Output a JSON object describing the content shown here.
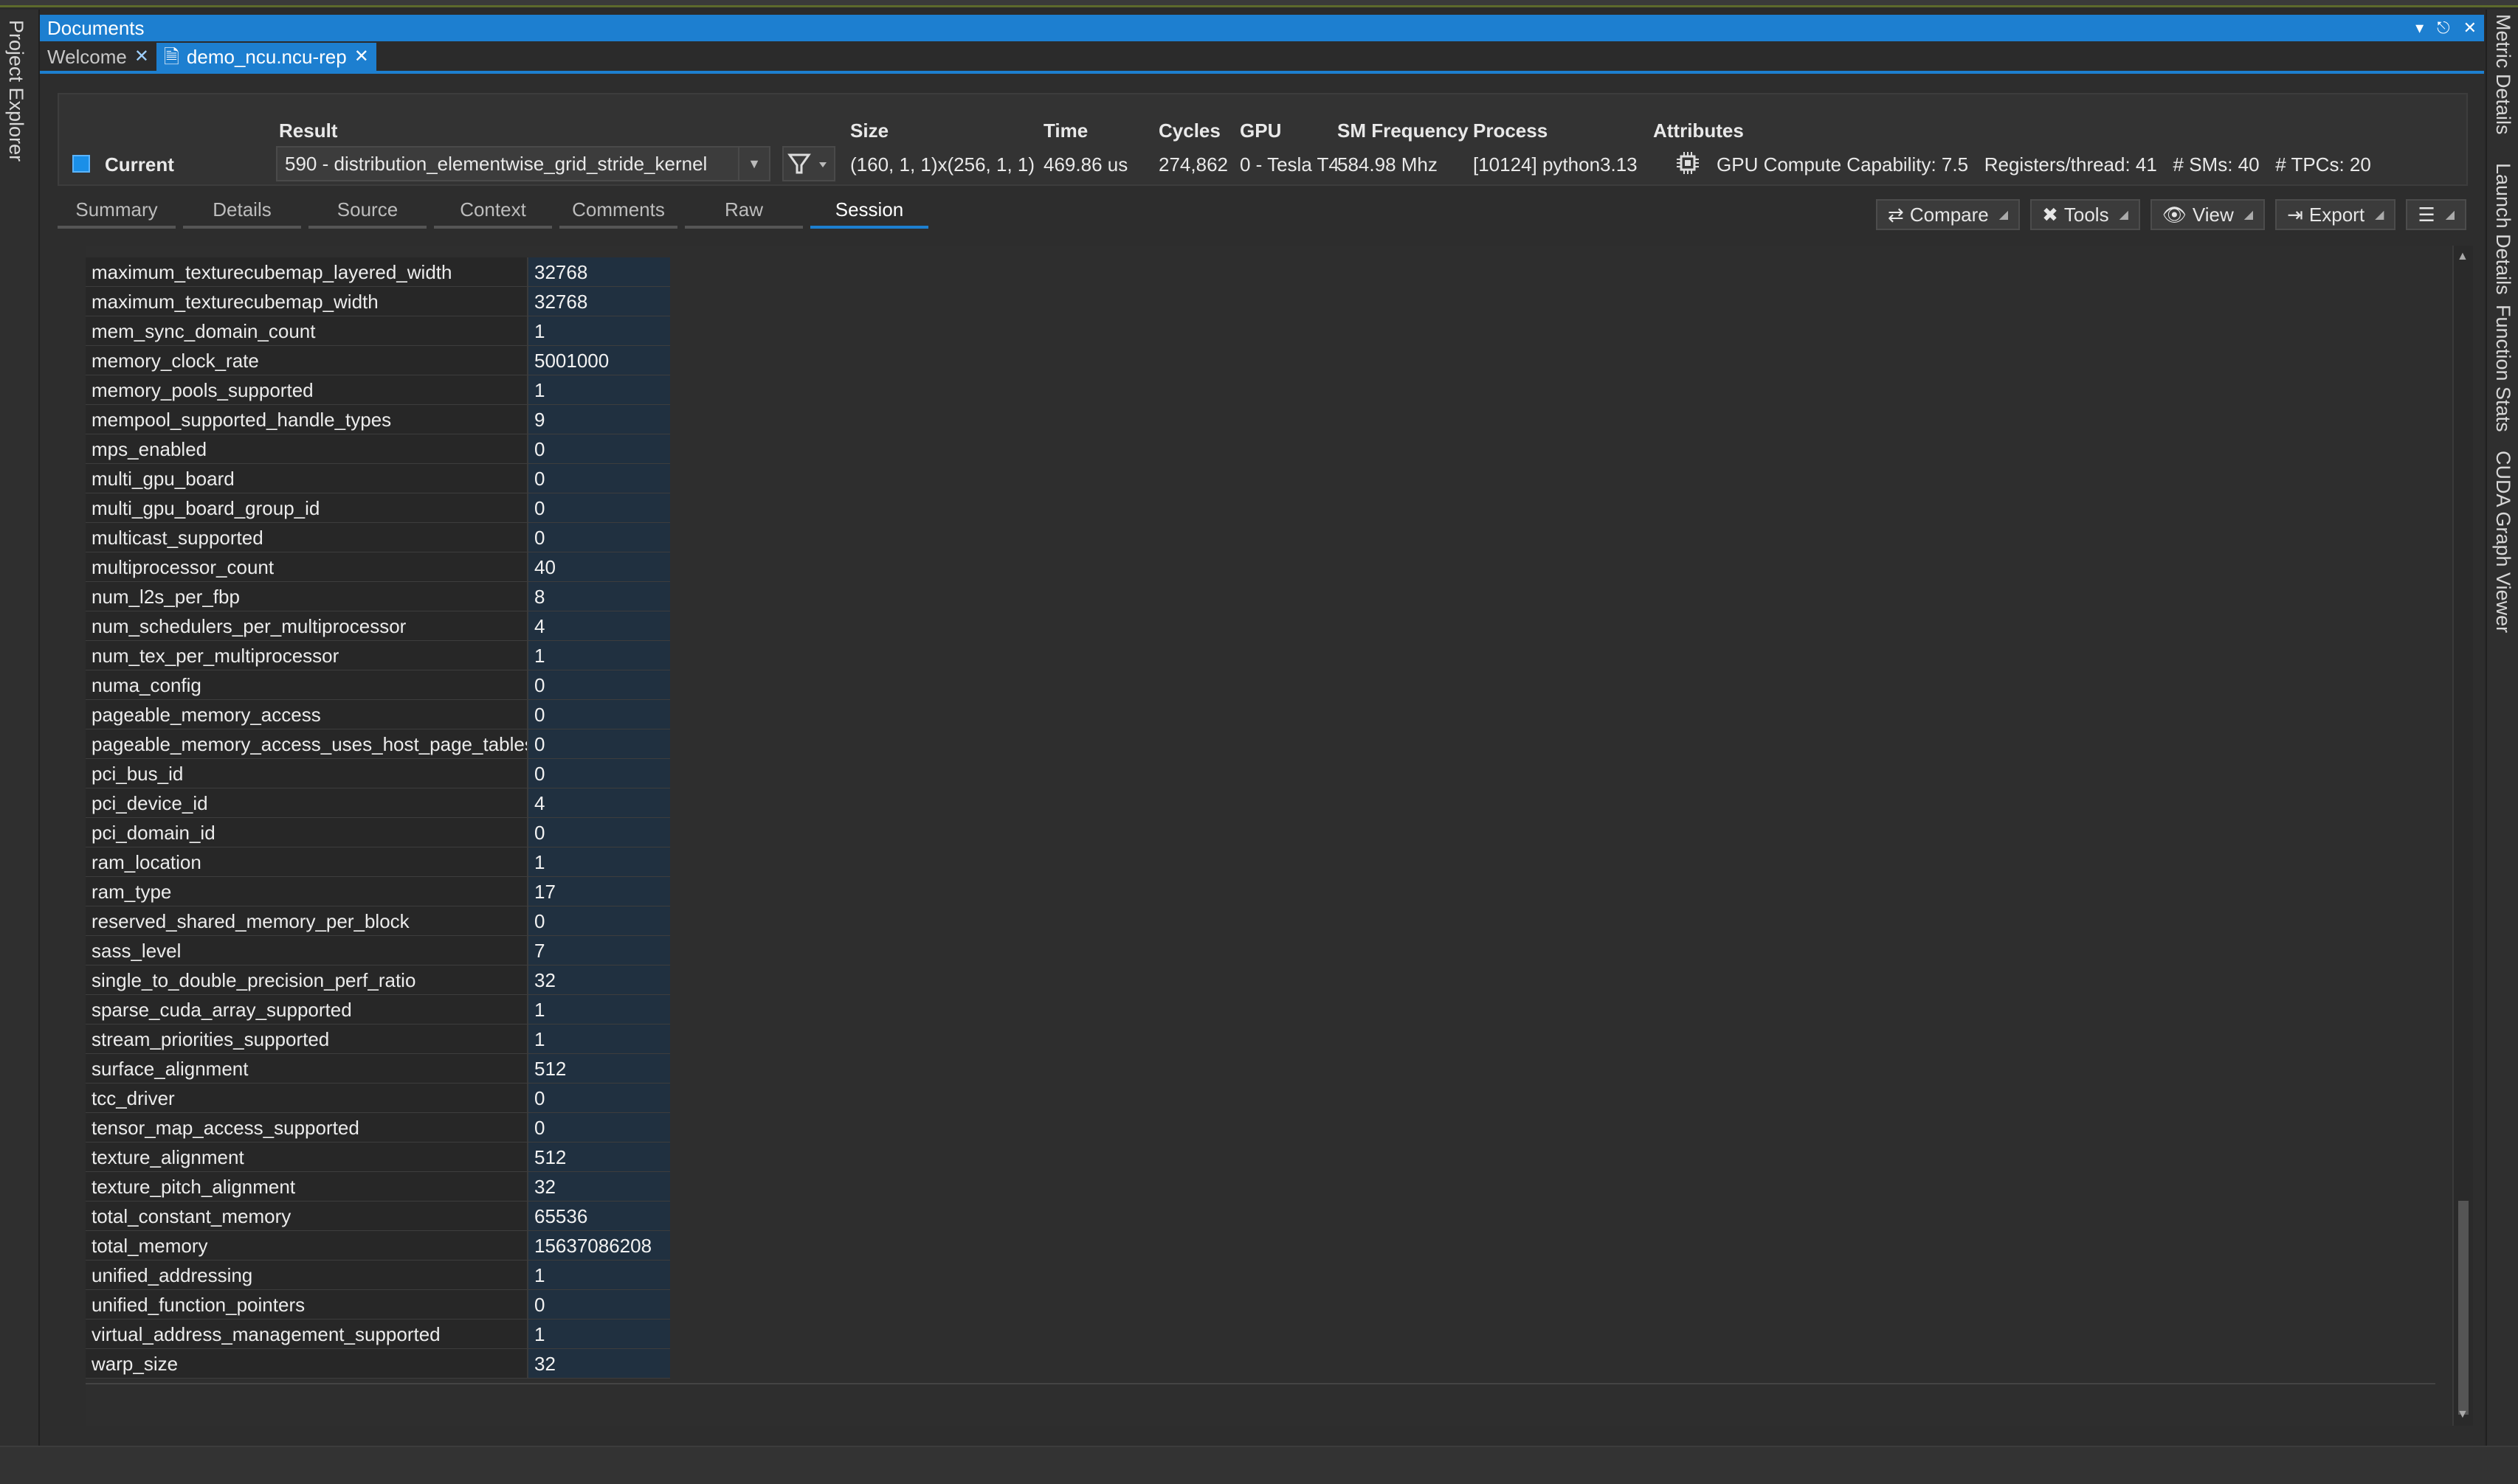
{
  "side_left": {
    "project_explorer": "Project Explorer"
  },
  "side_right": {
    "metric_details": "Metric Details",
    "launch_details": "Launch Details",
    "function_stats": "Function Stats",
    "cuda_graph_viewer": "CUDA Graph Viewer"
  },
  "window": {
    "title": "Documents"
  },
  "doc_tabs": [
    {
      "label": "Welcome"
    },
    {
      "label": "demo_ncu.ncu-rep"
    }
  ],
  "header": {
    "current_label": "Current",
    "result_label": "Result",
    "result_value": "590 - distribution_elementwise_grid_stride_kernel",
    "size_label": "Size",
    "size_value": "(160, 1, 1)x(256, 1, 1)",
    "time_label": "Time",
    "time_value": "469.86 us",
    "cycles_label": "Cycles",
    "cycles_value": "274,862",
    "gpu_label": "GPU",
    "gpu_value": "0 - Tesla T4",
    "smfreq_label": "SM Frequency",
    "smfreq_value": "584.98 Mhz",
    "process_label": "Process",
    "process_value": "[10124] python3.13",
    "attributes_label": "Attributes",
    "attributes_value": "GPU Compute Capability: 7.5   Registers/thread: 41   # SMs: 40   # TPCs: 20"
  },
  "report_tabs": [
    "Summary",
    "Details",
    "Source",
    "Context",
    "Comments",
    "Raw",
    "Session"
  ],
  "toolbar": {
    "compare": "Compare",
    "tools": "Tools",
    "view": "View",
    "export": "Export"
  },
  "rows": [
    {
      "key": "maximum_texturecubemap_layered_width",
      "value": "32768"
    },
    {
      "key": "maximum_texturecubemap_width",
      "value": "32768"
    },
    {
      "key": "mem_sync_domain_count",
      "value": "1"
    },
    {
      "key": "memory_clock_rate",
      "value": "5001000"
    },
    {
      "key": "memory_pools_supported",
      "value": "1"
    },
    {
      "key": "mempool_supported_handle_types",
      "value": "9"
    },
    {
      "key": "mps_enabled",
      "value": "0"
    },
    {
      "key": "multi_gpu_board",
      "value": "0"
    },
    {
      "key": "multi_gpu_board_group_id",
      "value": "0"
    },
    {
      "key": "multicast_supported",
      "value": "0"
    },
    {
      "key": "multiprocessor_count",
      "value": "40"
    },
    {
      "key": "num_l2s_per_fbp",
      "value": "8"
    },
    {
      "key": "num_schedulers_per_multiprocessor",
      "value": "4"
    },
    {
      "key": "num_tex_per_multiprocessor",
      "value": "1"
    },
    {
      "key": "numa_config",
      "value": "0"
    },
    {
      "key": "pageable_memory_access",
      "value": "0"
    },
    {
      "key": "pageable_memory_access_uses_host_page_tables",
      "value": "0"
    },
    {
      "key": "pci_bus_id",
      "value": "0"
    },
    {
      "key": "pci_device_id",
      "value": "4"
    },
    {
      "key": "pci_domain_id",
      "value": "0"
    },
    {
      "key": "ram_location",
      "value": "1"
    },
    {
      "key": "ram_type",
      "value": "17"
    },
    {
      "key": "reserved_shared_memory_per_block",
      "value": "0"
    },
    {
      "key": "sass_level",
      "value": "7"
    },
    {
      "key": "single_to_double_precision_perf_ratio",
      "value": "32"
    },
    {
      "key": "sparse_cuda_array_supported",
      "value": "1"
    },
    {
      "key": "stream_priorities_supported",
      "value": "1"
    },
    {
      "key": "surface_alignment",
      "value": "512"
    },
    {
      "key": "tcc_driver",
      "value": "0"
    },
    {
      "key": "tensor_map_access_supported",
      "value": "0"
    },
    {
      "key": "texture_alignment",
      "value": "512"
    },
    {
      "key": "texture_pitch_alignment",
      "value": "32"
    },
    {
      "key": "total_constant_memory",
      "value": "65536"
    },
    {
      "key": "total_memory",
      "value": "15637086208"
    },
    {
      "key": "unified_addressing",
      "value": "1"
    },
    {
      "key": "unified_function_pointers",
      "value": "0"
    },
    {
      "key": "virtual_address_management_supported",
      "value": "1"
    },
    {
      "key": "warp_size",
      "value": "32"
    }
  ],
  "colors": {
    "accent": "#1d7fd0",
    "value_bg": "#203040",
    "background": "#2b2b2b"
  }
}
